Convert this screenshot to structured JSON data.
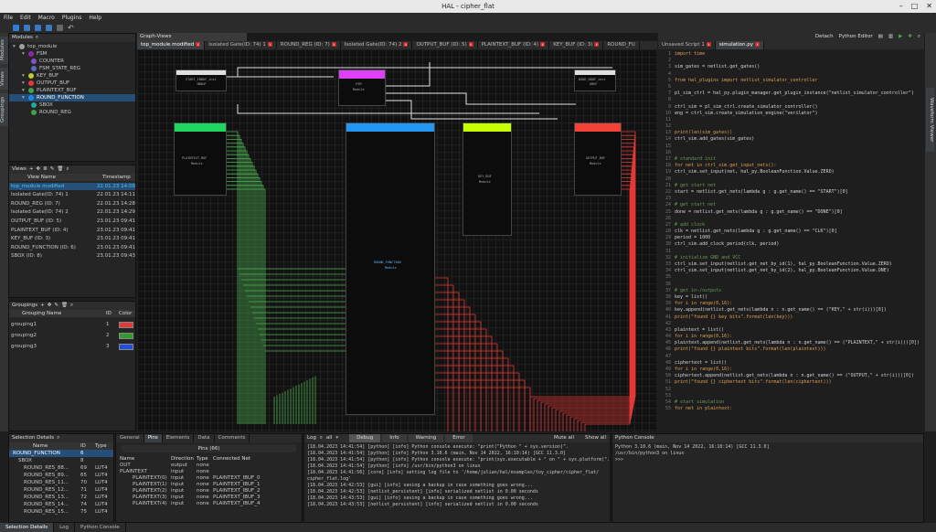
{
  "window": {
    "title": "HAL - cipher_flat"
  },
  "menu": [
    "File",
    "Edit",
    "Macro",
    "Plugins",
    "Help"
  ],
  "modules": {
    "header": "Modules",
    "items": [
      {
        "label": "top_module",
        "depth": 0,
        "color": "#9e9e9e"
      },
      {
        "label": "FSM",
        "depth": 1,
        "color": "#8e24aa"
      },
      {
        "label": "COUNTER",
        "depth": 2,
        "color": "#7e57c2"
      },
      {
        "label": "FSM_STATE_REG",
        "depth": 2,
        "color": "#5c6bc0"
      },
      {
        "label": "KEY_BUF",
        "depth": 1,
        "color": "#c0ca33"
      },
      {
        "label": "OUTPUT_BUF",
        "depth": 1,
        "color": "#e53935"
      },
      {
        "label": "PLAINTEXT_BUF",
        "depth": 1,
        "color": "#43a047"
      },
      {
        "label": "ROUND_FUNCTION",
        "depth": 1,
        "color": "#1e88e5"
      },
      {
        "label": "SBOX",
        "depth": 2,
        "color": "#26a69a"
      },
      {
        "label": "ROUND_REG",
        "depth": 2,
        "color": "#43a047"
      }
    ]
  },
  "views": {
    "header": "Views",
    "col_name": "View Name",
    "col_time": "Timestamp",
    "rows": [
      {
        "name": "top_module modified",
        "time": "22.01.23 14:06"
      },
      {
        "name": "Isolated Gate(ID: 74) 1",
        "time": "22.01.23 14:11"
      },
      {
        "name": "ROUND_REG (ID: 7)",
        "time": "22.01.23 14:28"
      },
      {
        "name": "Isolated Gate(ID: 74) 2",
        "time": "22.01.23 14:29"
      },
      {
        "name": "OUTPUT_BUF (ID: 5)",
        "time": "23.01.23 09:41"
      },
      {
        "name": "PLAINTEXT_BUF (ID: 4)",
        "time": "23.01.23 09:41"
      },
      {
        "name": "KEY_BUF (ID: 3)",
        "time": "23.01.23 09:41"
      },
      {
        "name": "ROUND_FUNCTION (ID: 6)",
        "time": "23.01.23 09:41"
      },
      {
        "name": "SBOX (ID: 8)",
        "time": "23.01.23 09:43"
      }
    ]
  },
  "groupings": {
    "header": "Groupings",
    "col_name": "Grouping Name",
    "col_id": "ID",
    "col_color": "Color",
    "rows": [
      {
        "name": "grouping1",
        "id": "1",
        "color": "#e53935"
      },
      {
        "name": "grouping2",
        "id": "2",
        "color": "#2e9d2e"
      },
      {
        "name": "grouping3",
        "id": "3",
        "color": "#1e4fe0"
      }
    ]
  },
  "graph": {
    "header": "Graph-Views",
    "tabs": [
      "top_module modified",
      "Isolated Gate(ID: 74) 1",
      "ROUND_REG (ID: 7)",
      "Isolated Gate(ID: 74) 2",
      "OUTPUT_BUF (ID: 5)",
      "PLAINTEXT_BUF (ID: 4)",
      "KEY_BUF (ID: 3)",
      "ROUND_FU"
    ],
    "gates": [
      {
        "label": "START_INBUF_inst",
        "sub": "INBUF"
      },
      {
        "label": "FSM",
        "sub": "Module"
      },
      {
        "label": "DONE_OBUF_inst",
        "sub": "OBUF"
      },
      {
        "label": "PLAINTEXT_BUF",
        "sub": "Module"
      },
      {
        "label": "ROUND_FUNCTION",
        "sub": "Module"
      },
      {
        "label": "KEY_BUF",
        "sub": "Module"
      },
      {
        "label": "OUTPUT_BUF",
        "sub": "Module"
      }
    ]
  },
  "python_editor": {
    "detach": "Detach",
    "header": "Python Editor",
    "tabs": [
      "Unsaved Script 1",
      "simulation.py"
    ],
    "lines": [
      "import time",
      "",
      "sim_gates = netlist.get_gates()",
      "",
      "from hal_plugins import netlist_simulator_controller",
      "",
      "pl_sim_ctrl = hal_py.plugin_manager.get_plugin_instance(\"netlist_simulator_controller\")",
      "",
      "ctrl_sim = pl_sim_ctrl.create_simulator_controller()",
      "eng = ctrl_sim.create_simulation_engine(\"verilator\")",
      "",
      "",
      "print(len(sim_gates))",
      "ctrl_sim.add_gates(sim_gates)",
      "",
      "",
      "# standard init",
      "for net in ctrl_sim.get_input_nets():",
      "    ctrl_sim.set_input(net, hal_py.BooleanFunction.Value.ZERO)",
      "",
      "# get start net",
      "start = netlist.get_nets(lambda g : g.get_name() == \"START\")[0]",
      "",
      "# get start net",
      "done = netlist.get_nets(lambda g : g.get_name() == \"DONE\")[0]",
      "",
      "# add clock",
      "clk = netlist.get_nets(lambda g : g.get_name() == \"CLK\")[0]",
      "period = 1000",
      "ctrl_sim.add_clock_period(clk, period)",
      "",
      "# initialize GND and VCC",
      "ctrl_sim.set_input(netlist.get_net_by_id(1), hal_py.BooleanFunction.Value.ZERO)",
      "ctrl_sim.set_input(netlist.get_net_by_id(2), hal_py.BooleanFunction.Value.ONE)",
      "",
      "",
      "# get in-/outputs",
      "key = list()",
      "for i in range(0,16):",
      "    key.append(netlist.get_nets(lambda n : n.get_name() == (\"KEY,\" + str(i)))[0])",
      "print(\"found {} key bits\".format(len(key)))",
      "",
      "plaintext = list()",
      "for i in range(0,16):",
      "    plaintext.append(netlist.get_nets(lambda n : n.get_name() == (\"PLAINTEXT,\" + str(i)))[0])",
      "print(\"found {} plaintext bits\".format(len(plaintext)))",
      "",
      "ciphertext = list()",
      "for i in range(0,16):",
      "    ciphertext.append(netlist.get_nets(lambda n : n.get_name() == (\"OUTPUT,\" + str(i)))[0])",
      "print(\"found {} ciphertext bits\".format(len(ciphertext)))",
      "",
      "",
      "# start simulation",
      "for net in plaintext:"
    ]
  },
  "right_sidebar": {
    "label": "Waveform Viewer"
  },
  "left_sidebar": {
    "tabs": [
      "Modules",
      "Views",
      "Groupings"
    ]
  },
  "selection": {
    "header": "Selection Details",
    "col_name": "Name",
    "col_id": "ID",
    "col_type": "Type",
    "tree": [
      {
        "name": "ROUND_FUNCTION",
        "id": "6",
        "type": ""
      },
      {
        "name": "SBOX",
        "id": "8",
        "type": ""
      },
      {
        "name": "ROUND_RES_88...",
        "id": "69",
        "type": "LUT4"
      },
      {
        "name": "ROUND_RES_89...",
        "id": "65",
        "type": "LUT4"
      },
      {
        "name": "ROUND_RES_11...",
        "id": "70",
        "type": "LUT4"
      },
      {
        "name": "ROUND_RES_12...",
        "id": "71",
        "type": "LUT4"
      },
      {
        "name": "ROUND_RES_13...",
        "id": "72",
        "type": "LUT4"
      },
      {
        "name": "ROUND_RES_14...",
        "id": "74",
        "type": "LUT4"
      },
      {
        "name": "ROUND_RES_15...",
        "id": "75",
        "type": "LUT4"
      }
    ],
    "tabs": [
      "General",
      "Pins",
      "Elements",
      "Data",
      "Comments"
    ],
    "pins_count": "Pins (66)",
    "pin_cols": [
      "Name",
      "Direction",
      "Type",
      "Connected Net"
    ],
    "pins": [
      {
        "name": "OUT",
        "dir": "output",
        "type": "none",
        "net": "",
        "group": true
      },
      {
        "name": "PLAINTEXT",
        "dir": "input",
        "type": "none",
        "net": "",
        "group": true
      },
      {
        "name": "PLAINTEXT(0)",
        "dir": "input",
        "type": "none",
        "net": "PLAINTEXT_IBUF_0",
        "group": false
      },
      {
        "name": "PLAINTEXT(1)",
        "dir": "input",
        "type": "none",
        "net": "PLAINTEXT_IBUF_1",
        "group": false
      },
      {
        "name": "PLAINTEXT(2)",
        "dir": "input",
        "type": "none",
        "net": "PLAINTEXT_IBUF_2",
        "group": false
      },
      {
        "name": "PLAINTEXT(3)",
        "dir": "input",
        "type": "none",
        "net": "PLAINTEXT_IBUF_3",
        "group": false
      },
      {
        "name": "PLAINTEXT(4)",
        "dir": "input",
        "type": "none",
        "net": "PLAINTEXT_IBUF_4",
        "group": false
      }
    ]
  },
  "log": {
    "header": "Log",
    "filter": "all",
    "tabs": [
      "Debug",
      "Info",
      "Warning",
      "Error"
    ],
    "mute_all": "Mute all",
    "show_all": "Show all",
    "lines": [
      "[18.04.2023 14:41:54] [python] [info] Python console execute: \"print(\"Python \" + sys.version)\".",
      "[18.04.2023 14:41:54] [python] [info] Python 3.10.6 (main, Nov 14 2022, 16:10:14) [GCC 11.3.0]",
      "[18.04.2023 14:41:54] [python] [info] Python console execute: \"print(sys.executable + \" on \" + sys.platform)\".",
      "[18.04.2023 14:41:54] [python] [info] /usr/bin/python3 on linux",
      "[18.04.2023 14:41:56] [core] [info] setting log file to '/home/julian/hal/examples/toy_cipher/cipher_flat/",
      "cipher_flat.log'",
      "[18.04.2023 14:42:53] [gui] [info] saving a backup in case something goes wrong...",
      "[18.04.2023 14:42:53] [netlist_persistent] [info] serialized netlist in 0.00 seconds",
      "[18.04.2023 14:43:53] [gui] [info] saving a backup in case something goes wrong...",
      "[18.04.2023 14:43:53] [netlist_persistent] [info] serialized netlist in 0.00 seconds"
    ]
  },
  "python_console": {
    "header": "Python Console",
    "lines": [
      "Python 3.10.6 (main, Nov 14 2022, 16:10:14) [GCC 11.3.0]",
      "/usr/bin/python3 on linux",
      ">>>"
    ]
  },
  "bottom_tabs": [
    "Selection Details",
    "Log",
    "Python Console"
  ]
}
